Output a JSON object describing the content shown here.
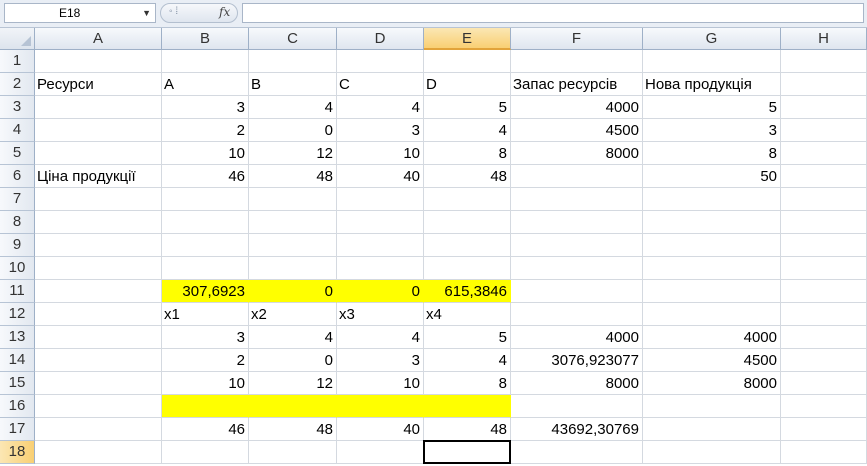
{
  "formula_bar": {
    "name_box": "E18",
    "fx_label": "fx",
    "formula": ""
  },
  "columns": [
    "A",
    "B",
    "C",
    "D",
    "E",
    "F",
    "G",
    "H"
  ],
  "rows": [
    "1",
    "2",
    "3",
    "4",
    "5",
    "6",
    "7",
    "8",
    "9",
    "10",
    "11",
    "12",
    "13",
    "14",
    "15",
    "16",
    "17",
    "18"
  ],
  "selected_cell": "E18",
  "highlight_color": "#ffff00",
  "cells": {
    "A2": "Ресурси",
    "B2": "A",
    "C2": "B",
    "D2": "C",
    "E2": "D",
    "F2": "Запас ресурсів",
    "G2": "Нова продукція",
    "B3": "3",
    "C3": "4",
    "D3": "4",
    "E3": "5",
    "F3": "4000",
    "G3": "5",
    "B4": "2",
    "C4": "0",
    "D4": "3",
    "E4": "4",
    "F4": "4500",
    "G4": "3",
    "B5": "10",
    "C5": "12",
    "D5": "10",
    "E5": "8",
    "F5": "8000",
    "G5": "8",
    "A6": "Ціна продукції",
    "B6": "46",
    "C6": "48",
    "D6": "40",
    "E6": "48",
    "G6": "50",
    "B11": "307,6923",
    "C11": "0",
    "D11": "0",
    "E11": "615,3846",
    "B12": "x1",
    "C12": "x2",
    "D12": "x3",
    "E12": "x4",
    "B13": "3",
    "C13": "4",
    "D13": "4",
    "E13": "5",
    "F13": "4000",
    "G13": "4000",
    "B14": "2",
    "C14": "0",
    "D14": "3",
    "E14": "4",
    "F14": "3076,923077",
    "G14": "4500",
    "B15": "10",
    "C15": "12",
    "D15": "10",
    "E15": "8",
    "F15": "8000",
    "G15": "8000",
    "B17": "46",
    "C17": "48",
    "D17": "40",
    "E17": "48",
    "F17": "43692,30769"
  },
  "yellow_cells": [
    "B11",
    "C11",
    "D11",
    "E11",
    "B16",
    "C16",
    "D16",
    "E16"
  ],
  "text_cells": [
    "A2",
    "B2",
    "C2",
    "D2",
    "E2",
    "F2",
    "G2",
    "A6",
    "B12",
    "C12",
    "D12",
    "E12"
  ]
}
